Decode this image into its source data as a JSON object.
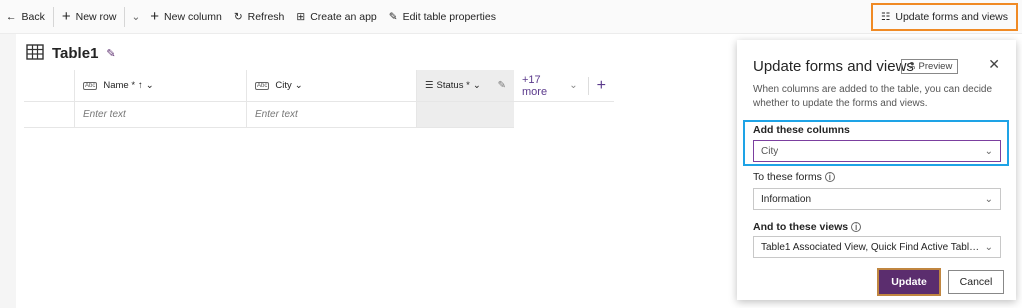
{
  "toolbar": {
    "back_label": "Back",
    "new_row_label": "New row",
    "new_column_label": "New column",
    "refresh_label": "Refresh",
    "create_app_label": "Create an app",
    "edit_props_label": "Edit table properties",
    "update_forms_label": "Update forms and views"
  },
  "table": {
    "title": "Table1",
    "columns": [
      {
        "type_tag": "Abc",
        "label": "Name *",
        "sort": "↑",
        "chevron": "⌄"
      },
      {
        "type_tag": "Abc",
        "label": "City",
        "chevron": "⌄"
      },
      {
        "type_tag": "☰",
        "label": "Status *",
        "chevron": "⌄"
      }
    ],
    "more_label": "+17 more",
    "row_placeholders": [
      "Enter text",
      "Enter text"
    ]
  },
  "panel": {
    "title": "Update forms and views",
    "preview_label": "Preview",
    "description": "When columns are added to the table, you can decide whether to update the forms and views.",
    "add_columns_label": "Add these columns",
    "add_columns_value": "City",
    "forms_label": "To these forms",
    "forms_value": "Information",
    "views_label": "And to these views",
    "views_value": "Table1 Associated View, Quick Find Active Table1, ...",
    "update_label": "Update",
    "cancel_label": "Cancel"
  },
  "colors": {
    "accent": "#5b2d6e",
    "highlight_orange": "#f08a24",
    "highlight_blue": "#1ea3e6"
  }
}
